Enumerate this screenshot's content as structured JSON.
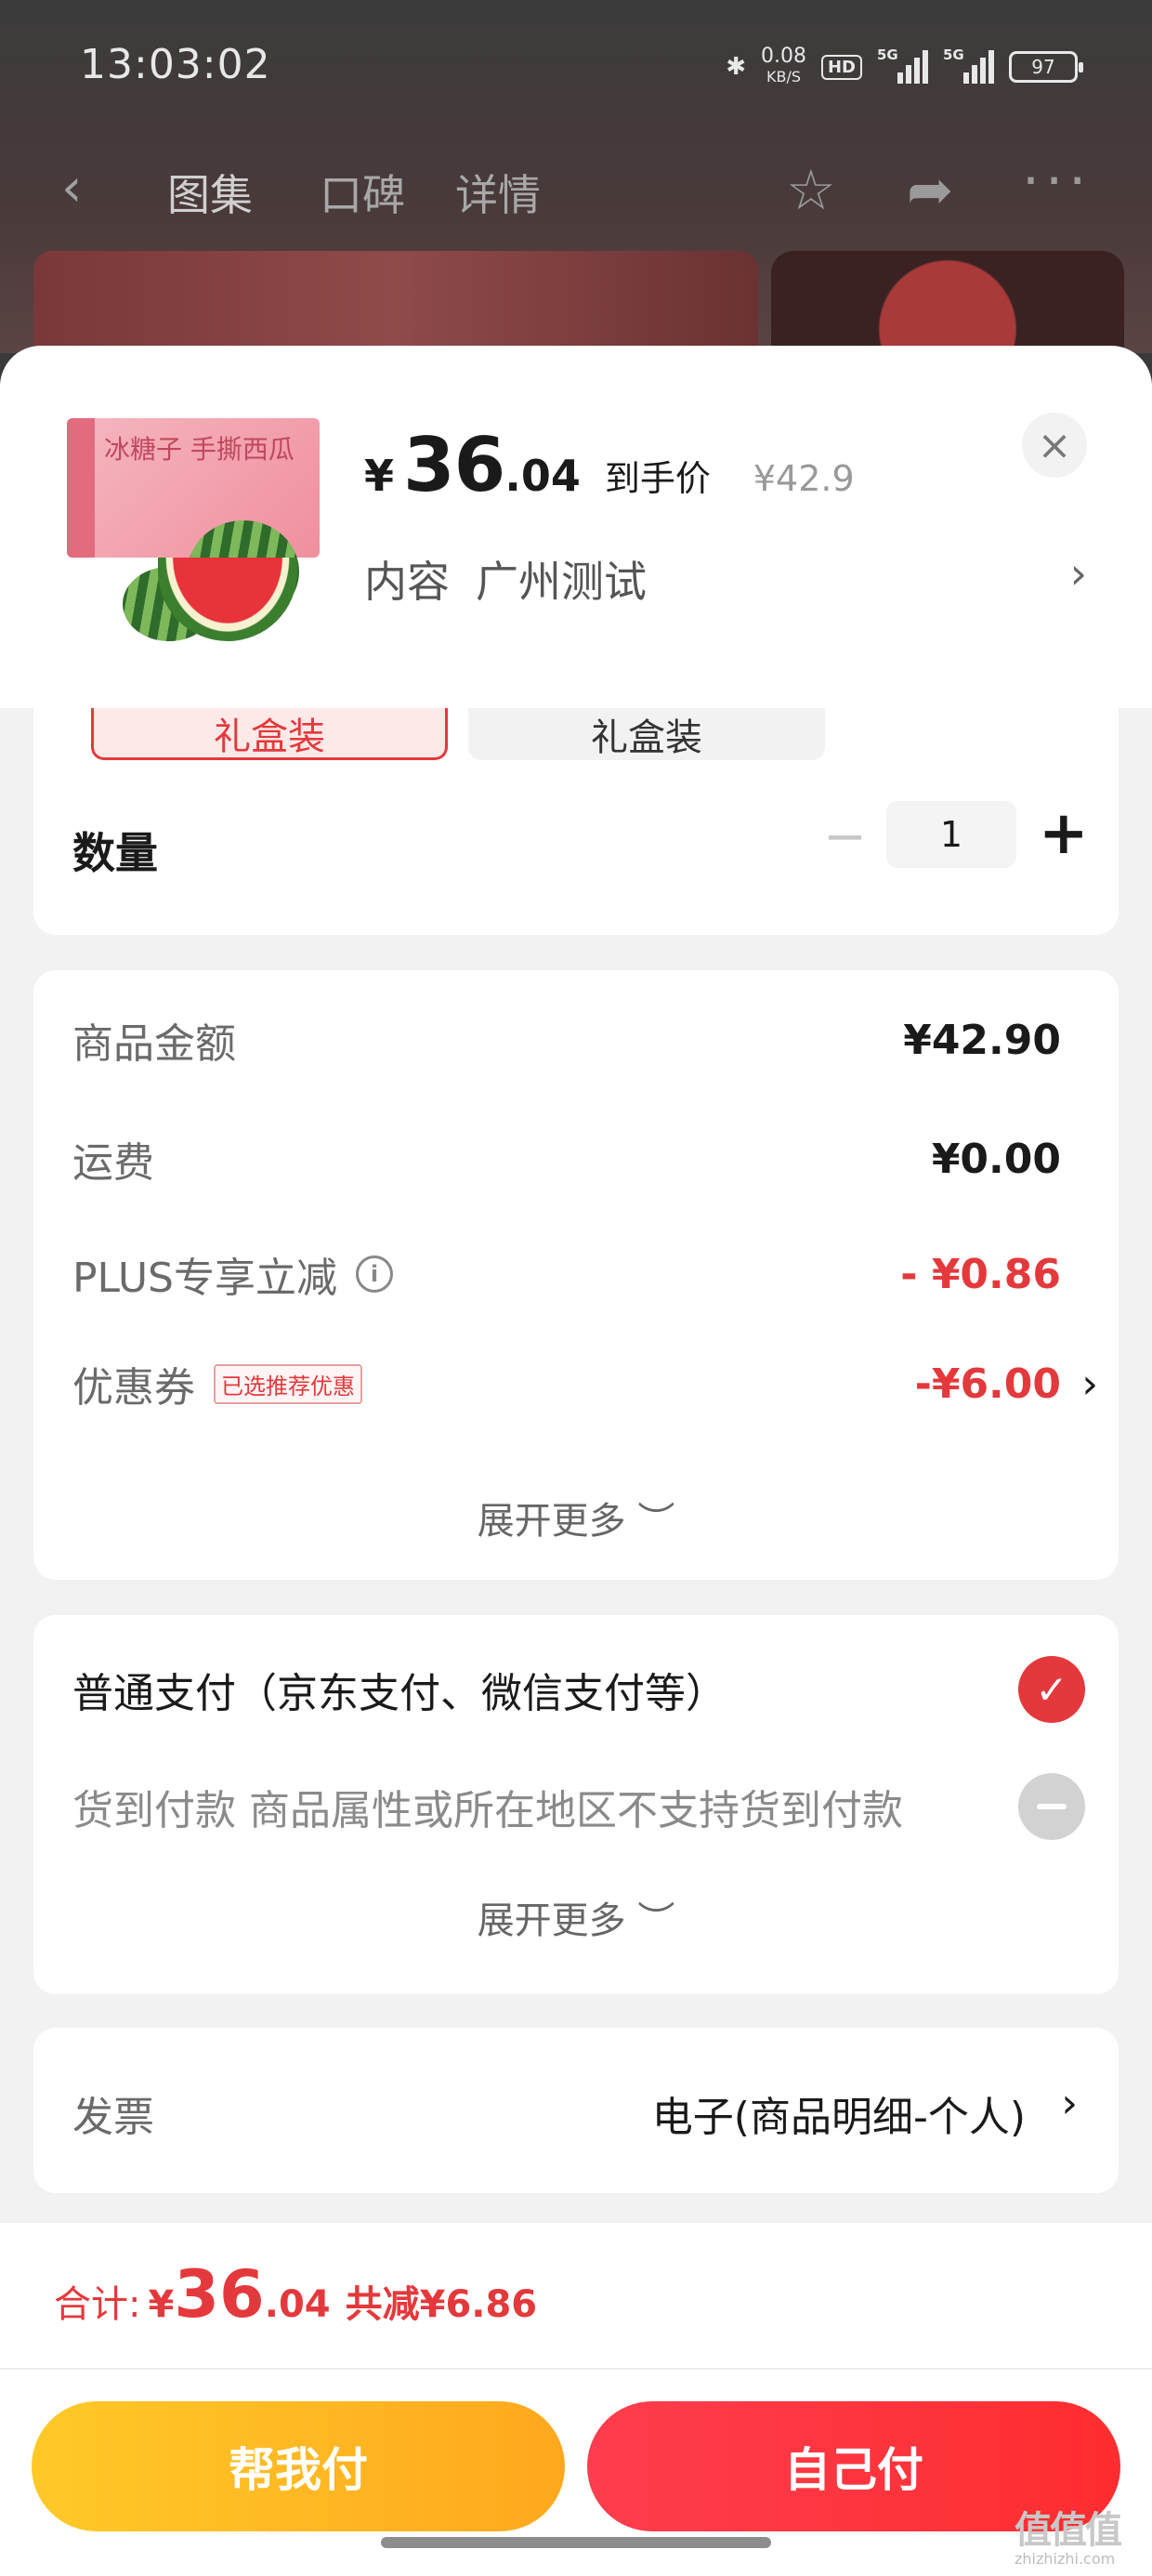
{
  "status_bar": {
    "time": "13:03:02",
    "net_speed": "0.08",
    "net_unit": "KB/S",
    "hd": "HD",
    "signal_1": "5G",
    "signal_2": "5G",
    "battery": "97"
  },
  "nav": {
    "tabs": [
      {
        "label": "图集"
      },
      {
        "label": "口碑"
      },
      {
        "label": "详情"
      }
    ]
  },
  "sheet": {
    "price": {
      "symbol": "¥",
      "integer": "36",
      "decimal": ".04",
      "label": "到手价",
      "original": "¥42.9"
    },
    "spec": {
      "label": "内容",
      "value": "广州测试"
    },
    "product_box_text": "冰糖子 手撕西瓜",
    "options": [
      {
        "label": "礼盒装",
        "selected": true
      },
      {
        "label": "礼盒装",
        "selected": false
      }
    ],
    "quantity": {
      "label": "数量",
      "value": "1"
    },
    "breakdown": {
      "items": [
        {
          "label": "商品金额",
          "value": "¥42.90"
        },
        {
          "label": "运费",
          "value": "¥0.00"
        },
        {
          "label": "PLUS专享立减",
          "value": "- ¥0.86"
        },
        {
          "label": "优惠券",
          "tag": "已选推荐优惠",
          "value": "-¥6.00"
        }
      ],
      "expand": "展开更多 ︶"
    },
    "payment": {
      "options": [
        {
          "label": "普通支付（京东支付、微信支付等）",
          "checked": true
        },
        {
          "label": "货到付款 商品属性或所在地区不支持货到付款",
          "disabled": true
        }
      ],
      "expand": "展开更多 ︶"
    },
    "invoice": {
      "label": "发票",
      "value": "电子(商品明细-个人)"
    }
  },
  "footer": {
    "total_label": "合计:",
    "total_symbol": "¥",
    "total_integer": "36",
    "total_decimal": ".04",
    "total_saved": "共减¥6.86",
    "btn_help": "帮我付",
    "btn_self": "自己付"
  },
  "watermark": {
    "main": "值值值",
    "sub": "zhizhizhi.com"
  },
  "colors": {
    "accent_red": "#e4393c",
    "btn_yellow": "#ffb623",
    "btn_red": "#fe3443"
  },
  "icons": [
    "back-icon",
    "star-icon",
    "share-icon",
    "more-icon",
    "close-icon",
    "chevron-right-icon",
    "info-icon",
    "check-icon",
    "minus-icon",
    "plus-icon"
  ]
}
